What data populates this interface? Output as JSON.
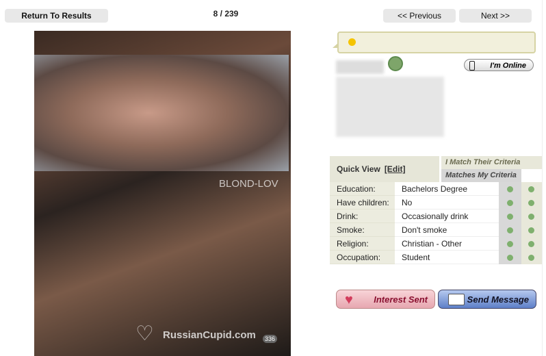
{
  "nav": {
    "return_label": "Return To Results",
    "pager": "8 / 239",
    "previous_label": "<< Previous",
    "next_label": "Next >>"
  },
  "photo": {
    "overlay_text": "BLOND-LOV",
    "watermark": "RussianCupid.com",
    "photo_count": "336"
  },
  "status": {
    "online_label": "I'm Online"
  },
  "quick_view": {
    "title": "Quick View",
    "edit_label": "[Edit]",
    "i_match_label": "I Match Their Criteria",
    "matches_my_label": "Matches My Criteria",
    "rows": [
      {
        "label": "Education:",
        "value": "Bachelors Degree"
      },
      {
        "label": "Have children:",
        "value": "No"
      },
      {
        "label": "Drink:",
        "value": "Occasionally drink"
      },
      {
        "label": "Smoke:",
        "value": "Don't smoke"
      },
      {
        "label": "Religion:",
        "value": "Christian - Other"
      },
      {
        "label": "Occupation:",
        "value": "Student"
      }
    ],
    "match_color": "#7fb06e"
  },
  "actions": {
    "interest_label": "Interest Sent",
    "message_label": "Send Message"
  }
}
